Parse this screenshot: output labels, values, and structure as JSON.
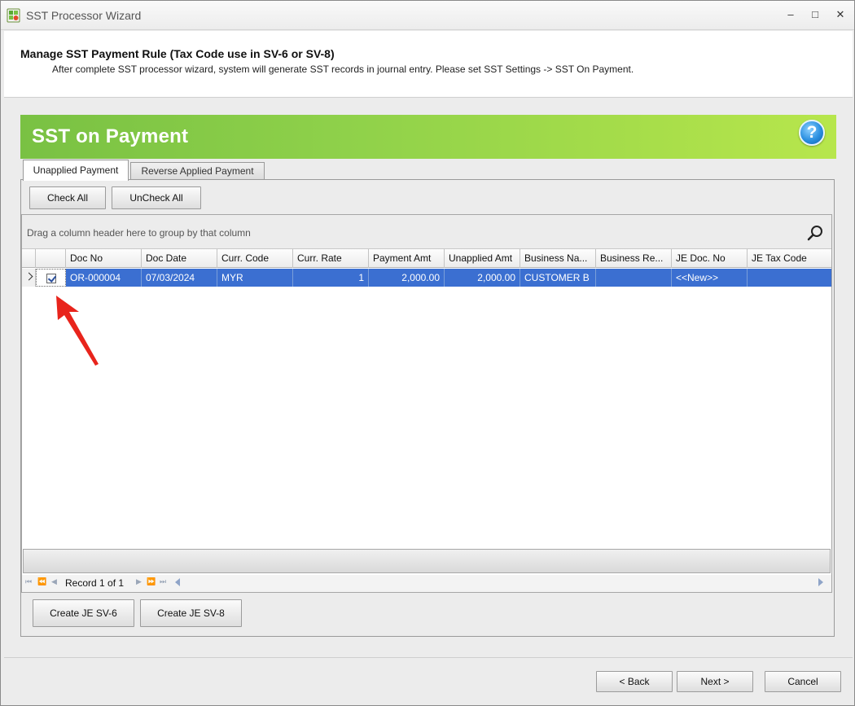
{
  "window": {
    "title": "SST Processor Wizard",
    "minimize": "–",
    "maximize": "□",
    "close": "✕"
  },
  "header": {
    "title": "Manage SST Payment Rule (Tax Code use in SV-6 or SV-8)",
    "description": "After complete SST processor wizard, system will generate SST records in journal entry. Please set SST Settings -> SST On Payment."
  },
  "banner": {
    "title": "SST on Payment",
    "help": "?"
  },
  "tabs": [
    {
      "label": "Unapplied Payment",
      "active": true
    },
    {
      "label": "Reverse Applied Payment",
      "active": false
    }
  ],
  "toolbar": {
    "check_all": "Check All",
    "uncheck_all": "UnCheck All"
  },
  "grid": {
    "group_hint": "Drag a column header here to group by that column",
    "columns": [
      "Doc No",
      "Doc Date",
      "Curr. Code",
      "Curr. Rate",
      "Payment Amt",
      "Unapplied Amt",
      "Business Na...",
      "Business Re...",
      "JE Doc. No",
      "JE Tax Code"
    ],
    "rows": [
      {
        "checked": true,
        "doc_no": "OR-000004",
        "doc_date": "07/03/2024",
        "curr_code": "MYR",
        "curr_rate": "1",
        "payment_amt": "2,000.00",
        "unapplied_amt": "2,000.00",
        "business_name": "CUSTOMER B",
        "business_reg": "",
        "je_doc_no": "<<New>>",
        "je_tax_code": ""
      }
    ],
    "record_text": "Record 1 of 1"
  },
  "actions": {
    "create_sv6": "Create JE SV-6",
    "create_sv8": "Create JE SV-8"
  },
  "footer": {
    "back": "< Back",
    "next": "Next >",
    "cancel": "Cancel"
  },
  "colors": {
    "banner_green": "#8fd14a",
    "selection_blue": "#3b6fd1",
    "annotation_red": "#e8241c"
  }
}
